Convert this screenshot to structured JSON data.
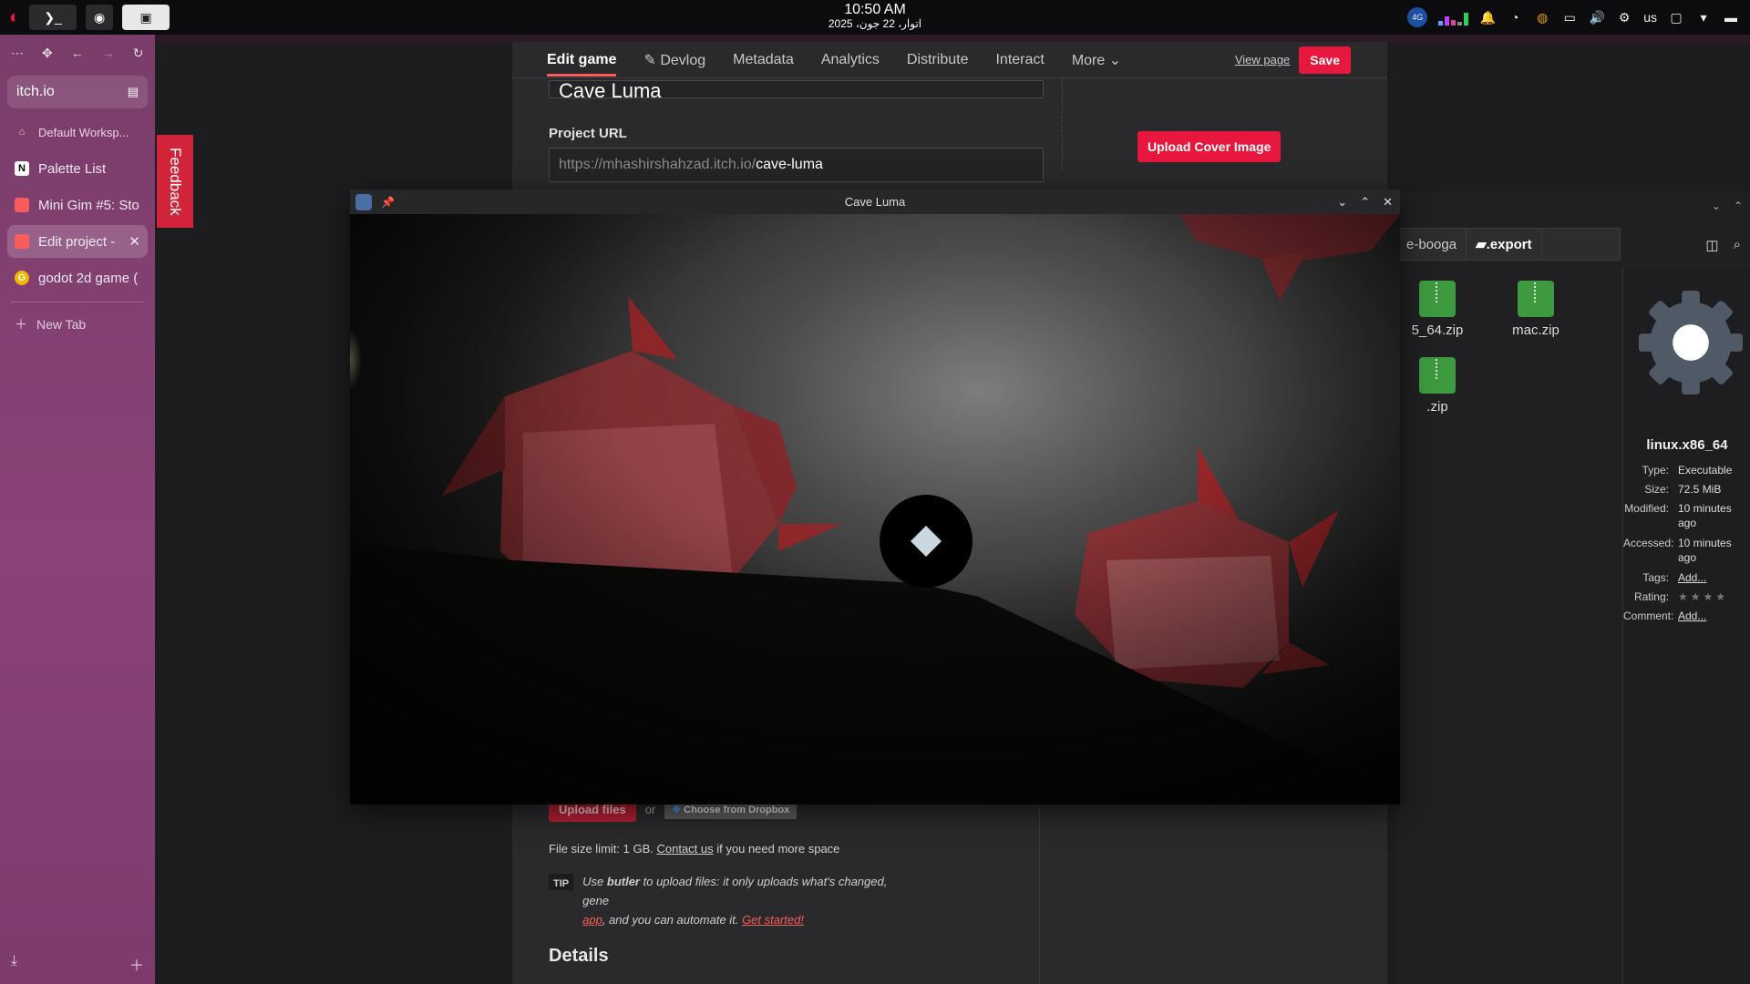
{
  "clock": {
    "time": "10:50 AM",
    "date": "اتوار، 22 جون، 2025"
  },
  "tray": {
    "network_badge": "4G",
    "keyboard_layout": "us"
  },
  "sidebar": {
    "url": "itch.io",
    "workspace": "Default Worksp...",
    "items": [
      {
        "label": "Palette List",
        "icon": "notion-icon"
      },
      {
        "label": "Mini Gim #5: Sto",
        "icon": "itch-icon"
      },
      {
        "label": "Edit project -",
        "icon": "itch-icon"
      },
      {
        "label": "godot 2d game (",
        "icon": "google-icon"
      }
    ],
    "new_tab": "New Tab"
  },
  "feedback": "Feedback",
  "page": {
    "tabs": [
      "Edit game",
      "Devlog",
      "Metadata",
      "Analytics",
      "Distribute",
      "Interact",
      "More"
    ],
    "view_page": "View page",
    "save": "Save",
    "title_value": "Cave Luma",
    "project_url_label": "Project URL",
    "project_url_prefix": "https://mhashirshahzad.itch.io/",
    "project_url_slug": "cave-luma",
    "upload_cover": "Upload Cover Image",
    "upload_files": "Upload files",
    "or": "or",
    "dropbox": "Choose from Dropbox",
    "limit_text": "File size limit: 1 GB.",
    "contact_us": "Contact us",
    "limit_suffix": "if you need more space",
    "tip_label": "TIP",
    "tip_pre": "Use",
    "tip_butler": "butler",
    "tip_mid": "to upload files: it only uploads what's changed, gene",
    "tip_app": "app",
    "tip_end": ", and you can automate it.",
    "get_started": "Get started!",
    "details": "Details"
  },
  "file_manager": {
    "path": [
      "e-booga",
      ".export"
    ],
    "files": [
      {
        "name": "5_64.zip"
      },
      {
        "name": "mac.zip"
      },
      {
        "name": ".zip"
      }
    ],
    "info": {
      "name": "linux.x86_64",
      "fields": [
        {
          "k": "Type:",
          "v": "Executable"
        },
        {
          "k": "Size:",
          "v": "72.5 MiB"
        },
        {
          "k": "Modified:",
          "v": "10 minutes ago"
        },
        {
          "k": "Accessed:",
          "v": "10 minutes ago"
        },
        {
          "k": "Tags:",
          "v": "Add..."
        },
        {
          "k": "Rating:",
          "v": "★★★★"
        },
        {
          "k": "Comment:",
          "v": "Add..."
        }
      ]
    }
  },
  "game_window": {
    "title": "Cave Luma"
  },
  "colors": {
    "accent": "#fa5c5c",
    "sidebar": "#8a4377",
    "save": "#e8173d"
  }
}
